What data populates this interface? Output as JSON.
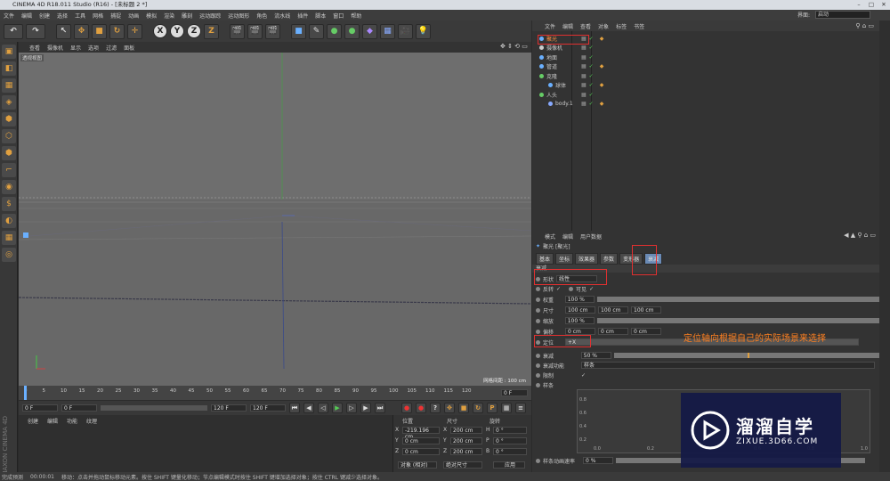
{
  "app": {
    "title": "CINEMA 4D R18.011 Studio (R16) - [未标题 2 *]",
    "layout_label": "界面:",
    "layout_value": "启动"
  },
  "menu": [
    "文件",
    "编辑",
    "创建",
    "选择",
    "工具",
    "网格",
    "捕捉",
    "动画",
    "模拟",
    "渲染",
    "雕刻",
    "运动跟踪",
    "运动图形",
    "角色",
    "流水线",
    "插件",
    "脚本",
    "窗口",
    "帮助"
  ],
  "toolbar": {
    "axis": [
      "X",
      "Y",
      "Z"
    ]
  },
  "viewport": {
    "menu": [
      "查看",
      "摄像机",
      "显示",
      "选项",
      "过滤",
      "面板"
    ],
    "label": "透视视图",
    "grid_info": "网格间距 : 100 cm"
  },
  "timeline": {
    "ticks": [
      "0",
      "5",
      "10",
      "15",
      "20",
      "25",
      "30",
      "35",
      "40",
      "45",
      "50",
      "55",
      "60",
      "65",
      "70",
      "75",
      "80",
      "85",
      "90",
      "95",
      "100",
      "105",
      "110",
      "115",
      "120"
    ],
    "frame_right": "0 F"
  },
  "frames": {
    "start": "0 F",
    "current": "0 F",
    "end1": "120 F",
    "end2": "120 F"
  },
  "bottom": {
    "tabs": [
      "创建",
      "编辑",
      "功能",
      "纹理"
    ],
    "col_headers": [
      "位置",
      "尺寸",
      "旋转"
    ],
    "rows": [
      {
        "axis": "X",
        "pos": "-219.196 cm",
        "size_axis": "X",
        "size": "200 cm",
        "rot_axis": "H",
        "rot": "0 °"
      },
      {
        "axis": "Y",
        "pos": "0 cm",
        "size_axis": "Y",
        "size": "200 cm",
        "rot_axis": "P",
        "rot": "0 °"
      },
      {
        "axis": "Z",
        "pos": "0 cm",
        "size_axis": "Z",
        "size": "200 cm",
        "rot_axis": "B",
        "rot": "0 °"
      }
    ],
    "mode1": "对象 (相对)",
    "mode2": "绝对尺寸",
    "apply": "应用"
  },
  "status": {
    "time": "00:00:01",
    "label": "完成预测",
    "text": "移动：点击并拖动鼠标移动元素。按住 SHIFT 键量化移动；节点编辑模式时按住 SHIFT 键增加选择对象；按住 CTRL 键减少选择对象。"
  },
  "objects": {
    "menu": [
      "文件",
      "编辑",
      "查看",
      "对象",
      "标签",
      "书签"
    ],
    "items": [
      {
        "name": "聚光",
        "indent": 0
      },
      {
        "name": "摄像机",
        "indent": 0
      },
      {
        "name": "地面",
        "indent": 0
      },
      {
        "name": "管道",
        "indent": 0
      },
      {
        "name": "克隆",
        "indent": 0
      },
      {
        "name": "球体",
        "indent": 1
      },
      {
        "name": "人头",
        "indent": 0
      },
      {
        "name": "body.1",
        "indent": 1
      }
    ]
  },
  "attributes": {
    "menu": [
      "模式",
      "编辑",
      "用户数据"
    ],
    "object_label": "聚光 [聚光]",
    "tabs": [
      "基本",
      "坐标",
      "效果器",
      "参数",
      "变形器",
      "衰减"
    ],
    "section": "衰减",
    "shape_label": "形状",
    "shape_value": "线性",
    "invert_label": "反转",
    "visible_label": "可见",
    "weight_label": "权重",
    "weight_value": "100 %",
    "size_label": "尺寸",
    "size_values": [
      "100 cm",
      "100 cm",
      "100 cm"
    ],
    "scale_label": "缩放",
    "scale_value": "100 %",
    "offset_label": "偏移",
    "offset_values": [
      "0 cm",
      "0 cm",
      "0 cm"
    ],
    "orient_label": "定位",
    "orient_value": "+X",
    "falloff_label": "衰减",
    "falloff_value": "50 %",
    "falloff_fraction": 0.5,
    "falloff_func_label": "衰减功能",
    "falloff_func_value": "样条",
    "limit_label": "限制",
    "spline_label": "样条",
    "spline_anim_label": "样条动画速率",
    "spline_anim_value": "0 %",
    "graph_y": [
      "0.8",
      "0.6",
      "0.4",
      "0.2"
    ],
    "graph_x": [
      "0.0",
      "0.2",
      "0.4",
      "0.6",
      "0.8",
      "1.0"
    ]
  },
  "annotation": "定位轴向根据自己的实际场景来选择",
  "watermark": {
    "title": "溜溜自学",
    "url": "ZIXUE.3D66.COM"
  },
  "colors": {
    "accent_red": "#e03030",
    "note_orange": "#ff8020",
    "viewport_bg": "#6f6f6f"
  }
}
